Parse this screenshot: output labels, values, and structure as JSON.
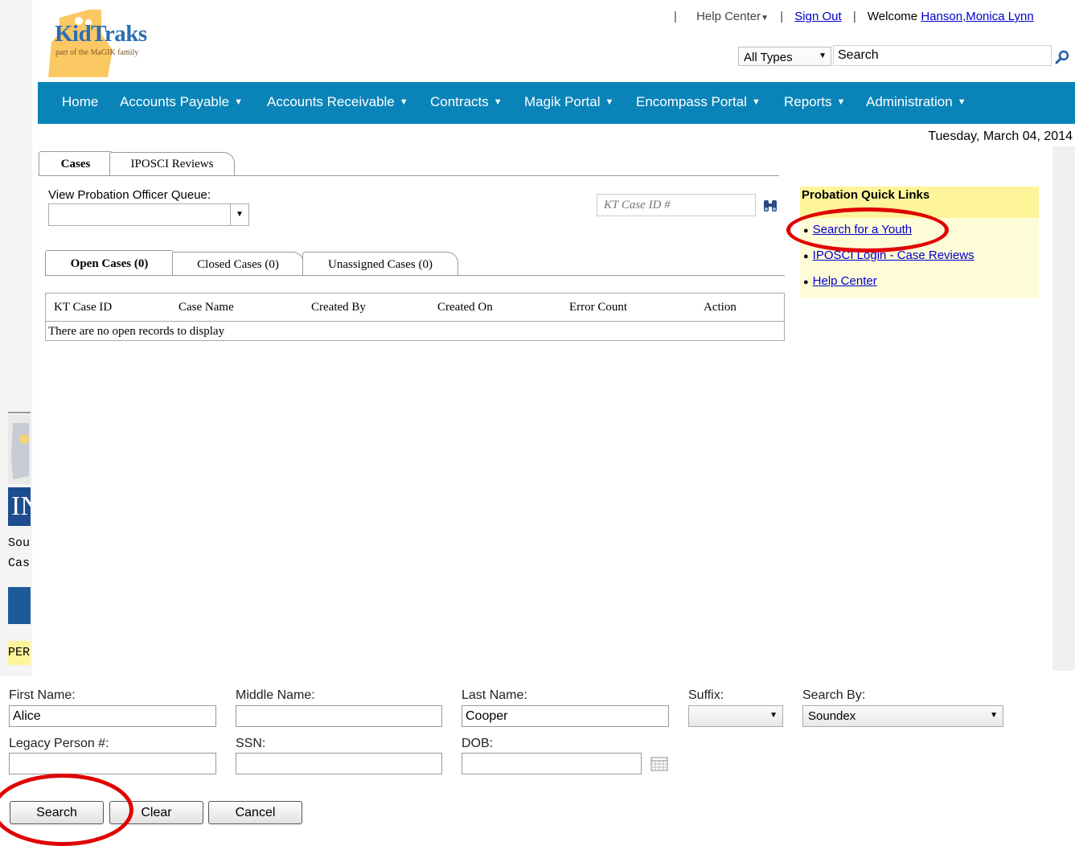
{
  "logo": {
    "title": "KidTraks",
    "subtitle": "part of the MaGIK family"
  },
  "top_links": {
    "sep": "|",
    "help_center": "Help Center",
    "sign_out": "Sign Out",
    "welcome_label": "Welcome",
    "user_name": "Hanson,Monica Lynn"
  },
  "search": {
    "type_value": "All Types",
    "input_value": "Search"
  },
  "nav": [
    {
      "label": "Home"
    },
    {
      "label": "Accounts Payable"
    },
    {
      "label": "Accounts Receivable"
    },
    {
      "label": "Contracts"
    },
    {
      "label": "Magik Portal"
    },
    {
      "label": "Encompass Portal"
    },
    {
      "label": "Reports"
    },
    {
      "label": "Administration"
    }
  ],
  "date": "Tuesday, March 04, 2014",
  "tabs": [
    {
      "label": "Cases"
    },
    {
      "label": "IPOSCI Reviews"
    }
  ],
  "queue": {
    "label": "View Probation Officer Queue:"
  },
  "case_id": {
    "placeholder": "KT Case ID #"
  },
  "subtabs": [
    {
      "label": "Open Cases (0)"
    },
    {
      "label": "Closed Cases (0)"
    },
    {
      "label": "Unassigned Cases (0)"
    }
  ],
  "table": {
    "columns": [
      "KT Case ID",
      "Case Name",
      "Created By",
      "Created On",
      "Error Count",
      "Action"
    ],
    "empty_message": "There are no open records to display"
  },
  "quick_links": {
    "title": "Probation Quick Links",
    "items": [
      {
        "label": "Search for a Youth"
      },
      {
        "label": "IPOSCI Login - Case Reviews"
      },
      {
        "label": "Help Center"
      }
    ]
  },
  "left_fragments": {
    "banner": "IN",
    "line1": "Sour",
    "line2": "Case",
    "yellow": "PER"
  },
  "form": {
    "first_name_label": "First Name:",
    "first_name_value": "Alice",
    "middle_name_label": "Middle Name:",
    "middle_name_value": "",
    "last_name_label": "Last Name:",
    "last_name_value": "Cooper",
    "suffix_label": "Suffix:",
    "suffix_value": "",
    "search_by_label": "Search By:",
    "search_by_value": "Soundex",
    "legacy_label": "Legacy Person #:",
    "legacy_value": "",
    "ssn_label": "SSN:",
    "ssn_value": "",
    "dob_label": "DOB:",
    "dob_value": ""
  },
  "buttons": {
    "search": "Search",
    "clear": "Clear",
    "cancel": "Cancel"
  },
  "colors": {
    "nav_bg": "#0a84b8",
    "quick_links_head": "#fef59a",
    "quick_links_body": "#fefbd8",
    "annotation": "#e00000"
  }
}
